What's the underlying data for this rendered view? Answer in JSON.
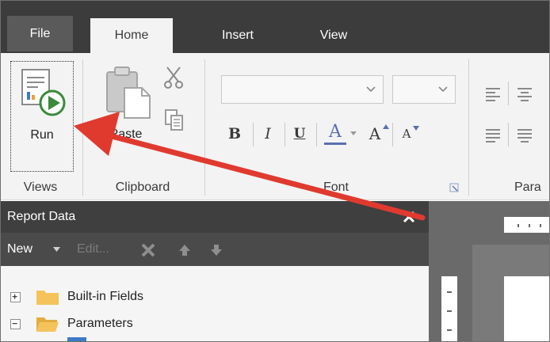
{
  "tabs": {
    "file": "File",
    "home": "Home",
    "insert": "Insert",
    "view": "View"
  },
  "ribbon": {
    "run_label": "Run",
    "paste_label": "Paste",
    "groups": {
      "views": "Views",
      "clipboard": "Clipboard",
      "font": "Font",
      "paragraph": "Para"
    },
    "font_name_value": "",
    "font_size_value": "",
    "format": {
      "bold": "B",
      "italic": "I",
      "underline": "U",
      "font_color": "A",
      "grow": "A",
      "shrink": "A"
    }
  },
  "report_data": {
    "title": "Report Data",
    "toolbar": {
      "new_label": "New",
      "edit_label": "Edit..."
    },
    "tree": [
      {
        "label": "Built-in Fields",
        "expander": "+"
      },
      {
        "label": "Parameters",
        "expander": "−"
      }
    ]
  },
  "colors": {
    "tab_bar": "#3c3c3c",
    "ribbon_bg": "#f3f3f3",
    "panel_header": "#3f3f3f",
    "annotation_arrow": "#e03a2f",
    "folder": "#f4c45b"
  },
  "icons": {
    "run": "run-report-icon",
    "paste": "paste-icon",
    "cut": "scissors-icon",
    "copy": "copy-icon",
    "close": "close-icon",
    "delete": "delete-icon",
    "up": "move-up-icon",
    "down": "move-down-icon",
    "folder": "folder-icon"
  }
}
